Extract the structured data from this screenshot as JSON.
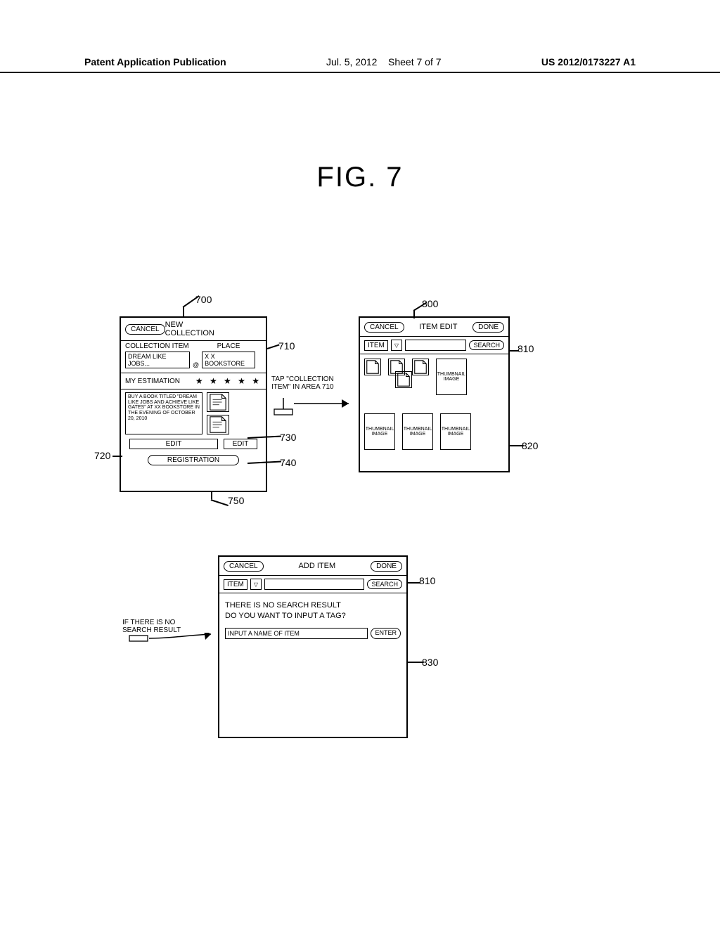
{
  "header": {
    "left": "Patent Application Publication",
    "mid_date": "Jul. 5, 2012",
    "mid_sheet": "Sheet 7 of 7",
    "right": "US 2012/0173227 A1"
  },
  "figure": {
    "title": "FIG. 7"
  },
  "callouts": {
    "c700": "700",
    "c710": "710",
    "c720": "720",
    "c730": "730",
    "c740": "740",
    "c750": "750",
    "c800": "800",
    "c810_a": "810",
    "c820": "820",
    "c810_b": "810",
    "c830": "830"
  },
  "annotations": {
    "tap_collection": "TAP \"COLLECTION ITEM\" IN AREA 710",
    "no_search_result": "IF THERE IS NO SEARCH RESULT"
  },
  "screen700": {
    "cancel": "CANCEL",
    "title": "NEW COLLECTION",
    "col_item_label": "COLLECTION ITEM",
    "place_label": "PLACE",
    "item_value": "DREAM LIKE JOBS...",
    "at": "@",
    "place_value": "X X BOOKSTORE",
    "my_est_label": "MY ESTIMATION",
    "stars": "★ ★ ★ ★ ★",
    "textblock": "BUY A BOOK TITLED \"DREAM LIKE JOBS AND ACHIEVE LIKE GATES\" AT XX BOOKSTORE IN THE EVENING OF OCTOBER 20, 2010",
    "edit": "EDIT",
    "registration": "REGISTRATION"
  },
  "screen800": {
    "cancel": "CANCEL",
    "title": "ITEM EDIT",
    "done": "DONE",
    "item": "ITEM",
    "dd": "▽",
    "search": "SEARCH",
    "thumb_label": "THUMBNAIL IMAGE"
  },
  "screenAdd": {
    "cancel": "CANCEL",
    "title": "ADD ITEM",
    "done": "DONE",
    "item": "ITEM",
    "dd": "▽",
    "search": "SEARCH",
    "msg1": "THERE IS NO SEARCH RESULT",
    "msg2": "DO YOU WANT TO INPUT A TAG?",
    "name_placeholder": "INPUT A NAME OF ITEM",
    "enter": "ENTER"
  }
}
